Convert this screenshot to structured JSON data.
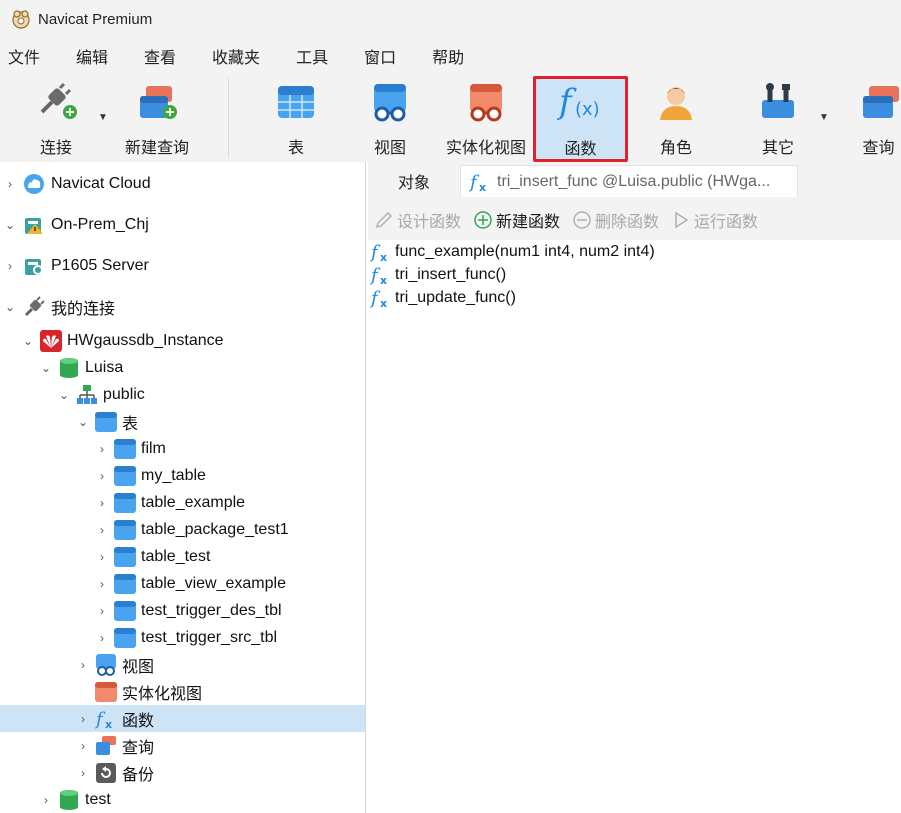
{
  "window": {
    "title": "Navicat Premium"
  },
  "menu": [
    "文件",
    "编辑",
    "查看",
    "收藏夹",
    "工具",
    "窗口",
    "帮助"
  ],
  "toolbar": {
    "connect": "连接",
    "new_query": "新建查询",
    "table": "表",
    "view": "视图",
    "mat_view": "实体化视图",
    "function": "函数",
    "role": "角色",
    "other": "其它",
    "query": "查询"
  },
  "nav": {
    "items": [
      {
        "label": "Navicat Cloud"
      },
      {
        "label": "On-Prem_Chj"
      },
      {
        "label": "P1605 Server"
      },
      {
        "label": "我的连接"
      },
      {
        "label": "HWgaussdb_Instance"
      },
      {
        "label": "Luisa"
      },
      {
        "label": "public"
      },
      {
        "label": "表"
      },
      {
        "label": "film"
      },
      {
        "label": "my_table"
      },
      {
        "label": "table_example"
      },
      {
        "label": "table_package_test1"
      },
      {
        "label": "table_test"
      },
      {
        "label": "table_view_example"
      },
      {
        "label": "test_trigger_des_tbl"
      },
      {
        "label": "test_trigger_src_tbl"
      },
      {
        "label": "视图"
      },
      {
        "label": "实体化视图"
      },
      {
        "label": "函数"
      },
      {
        "label": "查询"
      },
      {
        "label": "备份"
      },
      {
        "label": "test"
      }
    ]
  },
  "tabs": {
    "objects": "对象",
    "function_tab": "tri_insert_func @Luisa.public (HWga..."
  },
  "objbar": {
    "design": "设计函数",
    "new": "新建函数",
    "delete": "删除函数",
    "run": "运行函数"
  },
  "functions": [
    "func_example(num1 int4, num2 int4)",
    "tri_insert_func()",
    "tri_update_func()"
  ],
  "colors": {
    "accent": "#1e88e5",
    "selected_bg": "#cde4f7",
    "highlight_border": "#e0202a"
  }
}
